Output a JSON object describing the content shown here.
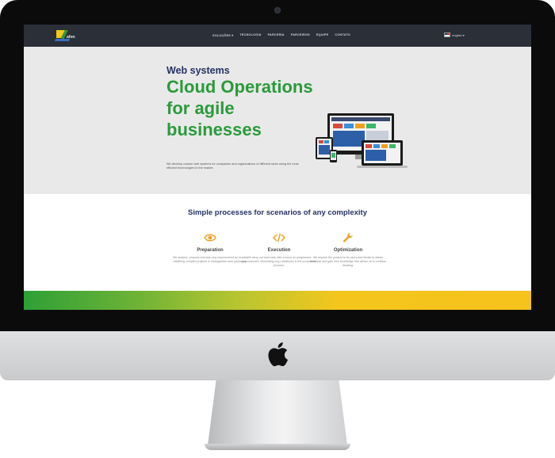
{
  "nav": {
    "logo_text": "afon",
    "menu": [
      "Soluções ▾",
      "Tecnologia",
      "Parceria",
      "Parceiros",
      "Equipe",
      "Contato"
    ],
    "language": "english ▾"
  },
  "hero": {
    "kicker": "Web systems",
    "headline": "Cloud Operations for agile businesses",
    "description": "We develop custom web systems for companies and organizations of different sizes using the most efficient technologies in the market."
  },
  "process": {
    "title": "Simple processes for scenarios of any complexity",
    "items": [
      {
        "title": "Preparation",
        "icon": "eye-icon",
        "desc": "We analyze, propose and plan any improvement by exactly obtaining complex projects in manageable work packages."
      },
      {
        "title": "Execution",
        "icon": "code-icon",
        "desc": "We carry out each task with a focus on progressive improvement, eliminating any roadblocks in the production process."
      },
      {
        "title": "Optimization",
        "icon": "wrench-icon",
        "desc": "We expose the product to its users and iterate to obtain feedback and gain new knowledge that allows us to continue iterating."
      }
    ]
  },
  "colors": {
    "nav_bg": "#2b2f38",
    "brand_green": "#2a9a3a",
    "brand_navy": "#253265",
    "accent_orange": "#f0a020",
    "bar_yellow": "#f6c21c"
  }
}
